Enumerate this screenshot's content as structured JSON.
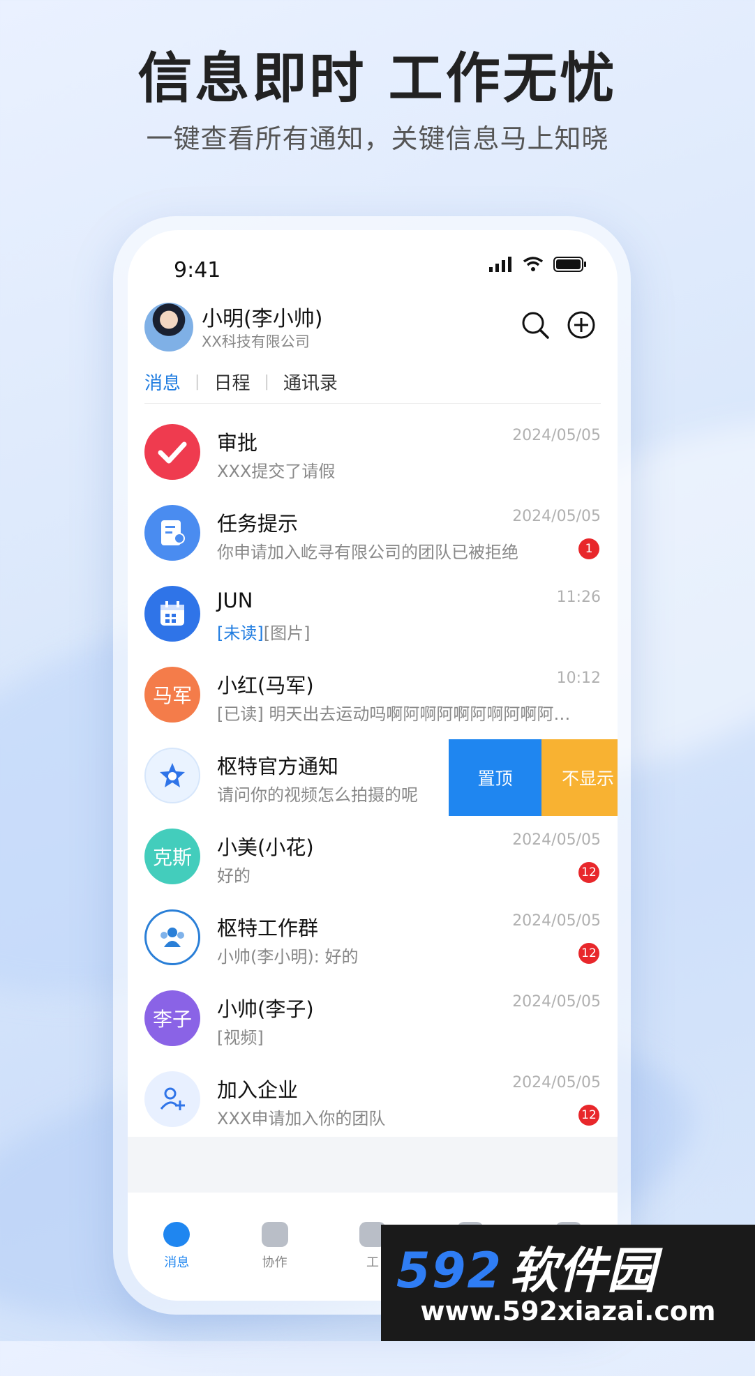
{
  "promo": {
    "headline": "信息即时 工作无忧",
    "subline": "一键查看所有通知，关键信息马上知晓"
  },
  "status_bar": {
    "time": "9:41"
  },
  "user": {
    "name": "小明(李小帅)",
    "company": "XX科技有限公司"
  },
  "tabs": [
    {
      "label": "消息",
      "active": true
    },
    {
      "label": "日程",
      "active": false
    },
    {
      "label": "通讯录",
      "active": false
    }
  ],
  "messages": [
    {
      "icon": "check-heart-icon",
      "color": "#ef3b4f",
      "title": "审批",
      "preview": "XXX提交了请假",
      "date": "2024/05/05"
    },
    {
      "icon": "task-card-icon",
      "color": "#4a8cf0",
      "title": "任务提示",
      "preview": "你申请加入屹寻有限公司的团队已被拒绝",
      "date": "2024/05/05",
      "badge": "1"
    },
    {
      "icon": "calendar-icon",
      "color": "#2f74e8",
      "title": "JUN",
      "unread": "[未读]",
      "preview": "[图片]",
      "date": "11:26"
    },
    {
      "avatar_text": "马军",
      "color": "#f47c4a",
      "title": "小红(马军)",
      "preview": "[已读] 明天出去运动吗啊阿啊阿啊阿啊阿啊阿…",
      "date": "10:12"
    },
    {
      "icon": "star-icon",
      "color": "#e9f2ff",
      "title": "枢特官方通知",
      "preview": "请问你的视频怎么拍摄的呢",
      "actions": {
        "pin": "置顶",
        "hide": "不显示"
      }
    },
    {
      "avatar_text": "克斯",
      "color": "#43cdbc",
      "title": "小美(小花)",
      "preview": "好的",
      "date": "2024/05/05",
      "badge": "12"
    },
    {
      "icon": "group-icon",
      "color": "#2a7fd7",
      "title": "枢特工作群",
      "preview": "小帅(李小明): 好的",
      "date": "2024/05/05",
      "badge": "12"
    },
    {
      "avatar_text": "李子",
      "color": "#8a63e6",
      "title": "小帅(李子)",
      "preview": "[视频]",
      "date": "2024/05/05"
    },
    {
      "icon": "add-user-icon",
      "color": "#e8f0ff",
      "title": "加入企业",
      "preview": "XXX申请加入你的团队",
      "date": "2024/05/05",
      "badge": "12"
    }
  ],
  "tabbar": [
    {
      "label": "消息",
      "icon": "chat-icon",
      "active": true
    },
    {
      "label": "协作",
      "icon": "collab-icon",
      "active": false
    },
    {
      "label": "工",
      "icon": "apps-icon",
      "active": false
    },
    {
      "label": "",
      "icon": "camera-icon",
      "active": false
    },
    {
      "label": "",
      "icon": "profile-icon",
      "active": false
    }
  ],
  "watermark": {
    "brand_num": "592",
    "brand_text": "软件园",
    "url": "www.592xiazai.com"
  }
}
